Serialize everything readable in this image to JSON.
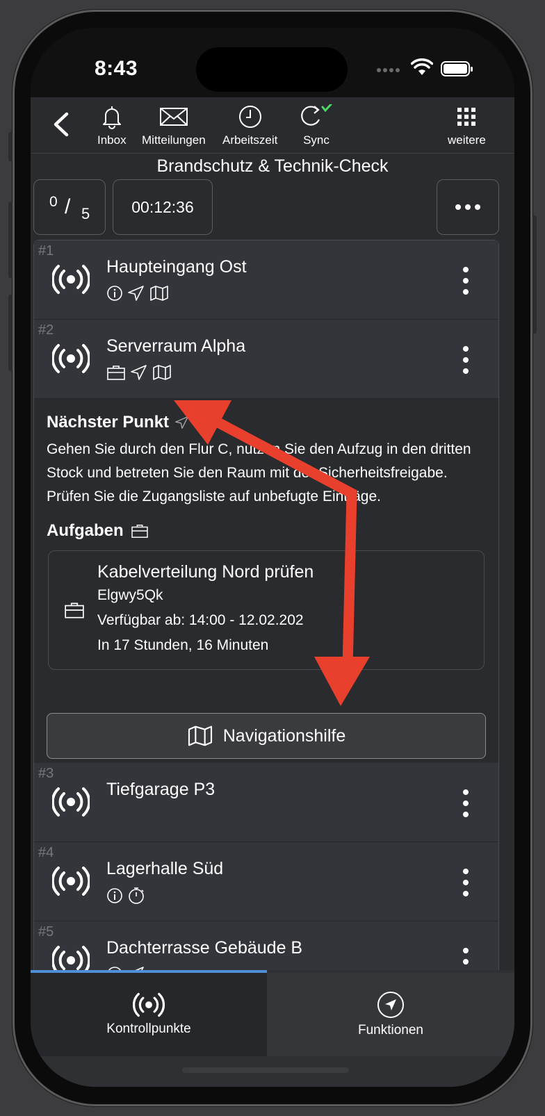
{
  "status_bar": {
    "time": "8:43"
  },
  "toolbar": {
    "inbox": "Inbox",
    "messages": "Mitteilungen",
    "worktime": "Arbeitszeit",
    "sync": "Sync",
    "more": "weitere"
  },
  "title": "Brandschutz & Technik-Check",
  "counter": {
    "done": "0",
    "slash": "/",
    "total": "5"
  },
  "timer": "00:12:36",
  "checkpoints": [
    {
      "index": "#1",
      "name": "Haupteingang Ost",
      "icons": [
        "info-icon",
        "navigation-icon",
        "map-icon"
      ]
    },
    {
      "index": "#2",
      "name": "Serverraum Alpha",
      "icons": [
        "briefcase-icon",
        "navigation-icon",
        "map-icon"
      ]
    },
    {
      "index": "#3",
      "name": "Tiefgarage P3",
      "icons": []
    },
    {
      "index": "#4",
      "name": "Lagerhalle Süd",
      "icons": [
        "info-icon",
        "stopwatch-icon"
      ]
    },
    {
      "index": "#5",
      "name": "Dachterrasse Gebäude B",
      "icons": [
        "info-icon",
        "navigation-icon"
      ]
    }
  ],
  "expanded": {
    "next_heading": "Nächster Punkt",
    "next_text": "Gehen Sie durch den Flur C, nutzen Sie den Aufzug in den dritten Stock und betreten Sie den Raum mit der Sicherheitsfreigabe. Prüfen Sie die Zugangsliste auf unbefugte Einträge.",
    "tasks_heading": "Aufgaben",
    "task": {
      "title": "Kabelverteilung Nord prüfen",
      "code": "Elgwy5Qk",
      "available": "Verfügbar ab: 14:00 - 12.02.202",
      "relative": "In 17 Stunden, 16 Minuten"
    },
    "nav_button": "Navigationshilfe"
  },
  "tabs": {
    "checkpoints": "Kontrollpunkte",
    "functions": "Funktionen"
  },
  "colors": {
    "annotation_arrow": "#e8402c",
    "sync_check": "#4cd964",
    "tab_indicator": "#4f8fd8"
  }
}
